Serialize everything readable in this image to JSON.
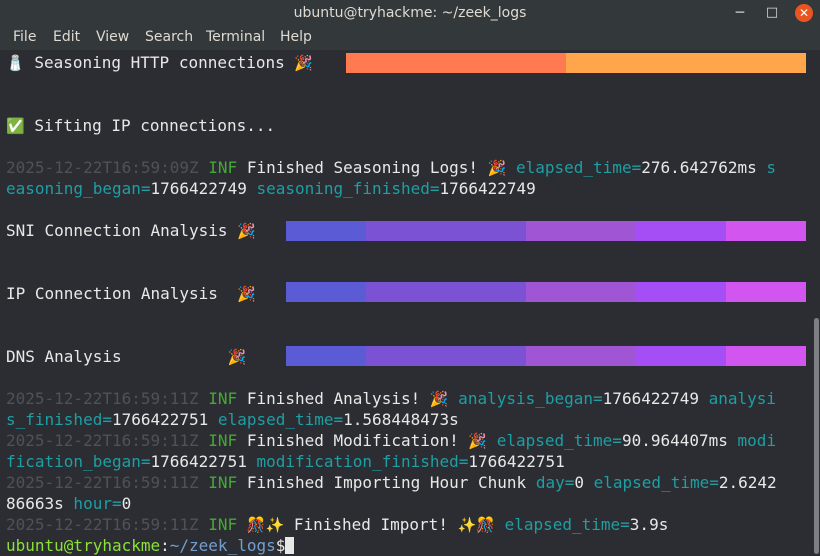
{
  "window": {
    "title": "ubuntu@tryhackme: ~/zeek_logs",
    "min_glyph": "─",
    "max_glyph": "□",
    "close_glyph": "✕"
  },
  "menu": [
    "File",
    "Edit",
    "View",
    "Search",
    "Terminal",
    "Help"
  ],
  "terminal": {
    "seasoning_http": {
      "icon": "🧂",
      "label": " Seasoning HTTP connections ",
      "emoji": "🎉"
    },
    "sifting_ip": {
      "icon": "✅",
      "label": " Sifting IP connections..."
    },
    "log1": {
      "ts": "2025-12-22T16:59:09Z",
      "level": " INF ",
      "msg": "Finished Seasoning Logs! ",
      "emoji": "🎉",
      "k1": " elapsed_time=",
      "v1": "276.642762ms",
      "k2a": " s",
      "k2b": "easoning_began=",
      "v2": "1766422749",
      "k3": " seasoning_finished=",
      "v3": "1766422749"
    },
    "sni": {
      "label": "SNI Connection Analysis ",
      "emoji": "🎉"
    },
    "ip": {
      "label": "IP Connection Analysis  ",
      "emoji": "🎉"
    },
    "dns": {
      "label": "DNS Analysis           ",
      "emoji": "🎉"
    },
    "log2": {
      "ts": "2025-12-22T16:59:11Z",
      "level": " INF ",
      "msg": "Finished Analysis! ",
      "emoji": "🎉",
      "k1": " analysis_began=",
      "v1": "1766422749",
      "k2a": " analysi",
      "k2b": "s_finished=",
      "v2": "1766422751",
      "k3": " elapsed_time=",
      "v3": "1.568448473s"
    },
    "log3": {
      "ts": "2025-12-22T16:59:11Z",
      "level": " INF ",
      "msg": "Finished Modification! ",
      "emoji": "🎉",
      "k1": " elapsed_time=",
      "v1": "90.964407ms",
      "k2a": " modi",
      "k2b": "fication_began=",
      "v2": "1766422751",
      "k3": " modification_finished=",
      "v3": "1766422751"
    },
    "log4": {
      "ts": "2025-12-22T16:59:11Z",
      "level": " INF ",
      "msg": "Finished Importing Hour Chunk",
      "k1": " day=",
      "v1": "0",
      "k2": " elapsed_time=",
      "v2a": "2.6242",
      "v2b": "86663s",
      "k3": " hour=",
      "v3": "0"
    },
    "log5": {
      "ts": "2025-12-22T16:59:11Z",
      "level": " INF ",
      "emoji1": "🎊✨",
      "msg": " Finished Import! ",
      "emoji2": "✨🎊",
      "k1": " elapsed_time=",
      "v1": "3.9s"
    },
    "prompt": {
      "user": "ubuntu@tryhackme",
      "sep": ":",
      "path": "~/zeek_logs",
      "symbol": "$"
    }
  },
  "colors": {
    "http_bar": [
      "#ff7a50",
      "#ffa64d"
    ],
    "analysis_bar": [
      "#5b5bd6",
      "#7b52d4",
      "#a055d4",
      "#b75ee0",
      "#a64ef5",
      "#d255f0"
    ]
  }
}
